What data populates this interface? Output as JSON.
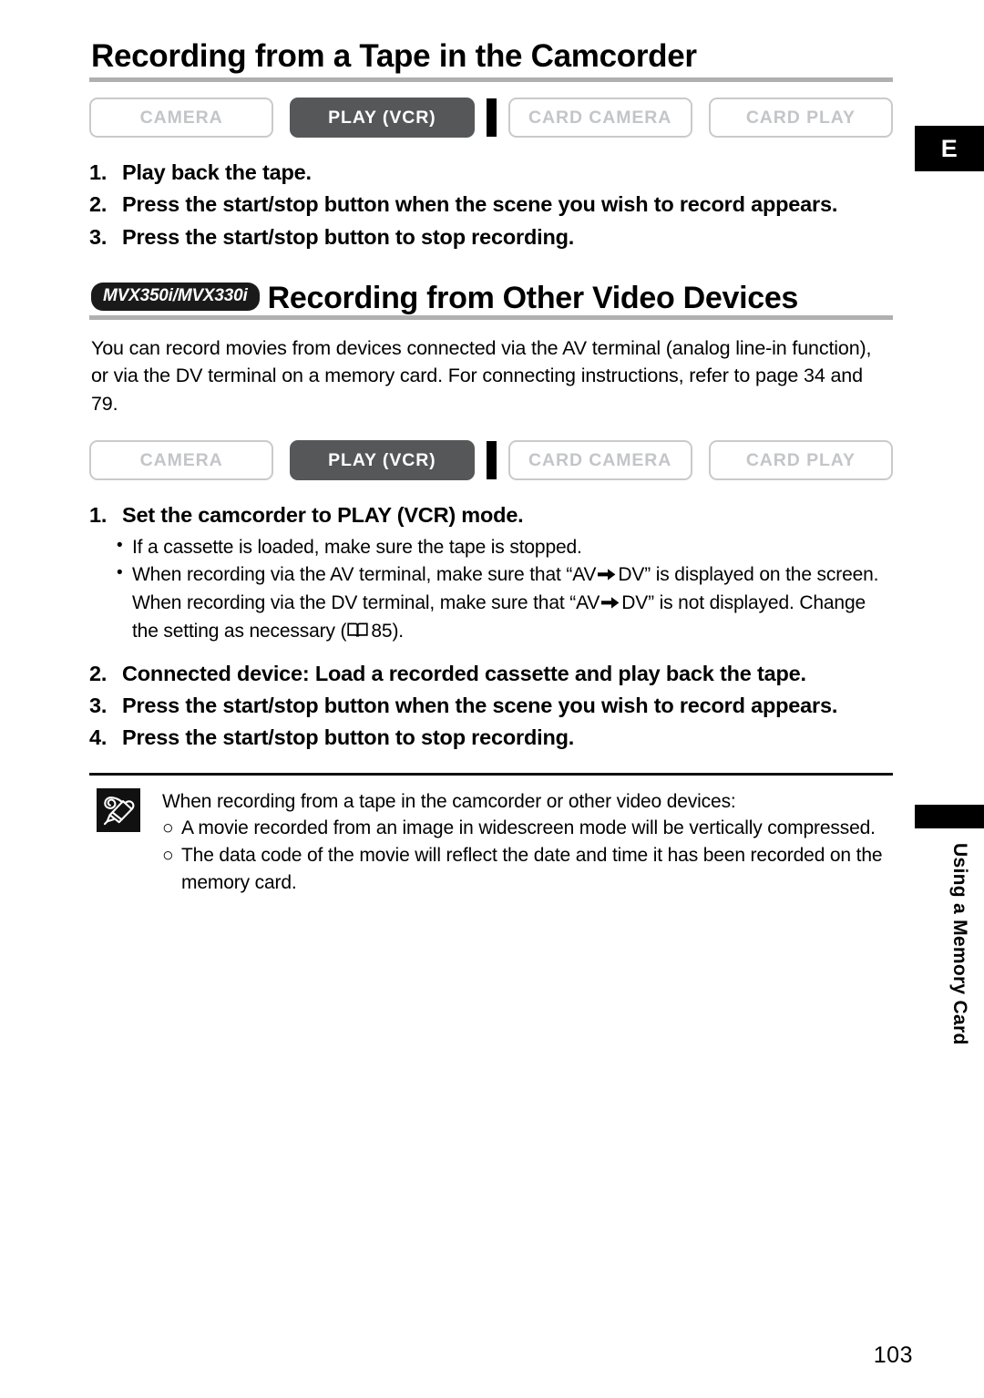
{
  "page": {
    "number": "103",
    "side_label": "Using a Memory Card",
    "edge_tab": "E"
  },
  "section1": {
    "heading": "Recording from a Tape in the Camcorder",
    "mode_bar": {
      "buttons": [
        {
          "label": "CAMERA",
          "state": "inactive"
        },
        {
          "label": "PLAY (VCR)",
          "state": "active"
        },
        {
          "label": "CARD CAMERA",
          "state": "inactive"
        },
        {
          "label": "CARD PLAY",
          "state": "inactive"
        }
      ]
    },
    "steps": [
      {
        "num": "1.",
        "text": "Play back the tape."
      },
      {
        "num": "2.",
        "text": "Press the start/stop button when the scene you wish to record appears."
      },
      {
        "num": "3.",
        "text": "Press the start/stop button to stop recording."
      }
    ]
  },
  "section2": {
    "badge": "MVX350i/MVX330i",
    "heading": "Recording from Other Video Devices",
    "paragraph": "You can record movies from devices connected via the AV terminal (analog line-in function), or via the DV terminal on a memory card. For connecting instructions, refer to page 34 and 79.",
    "mode_bar": {
      "buttons": [
        {
          "label": "CAMERA",
          "state": "inactive"
        },
        {
          "label": "PLAY (VCR)",
          "state": "active"
        },
        {
          "label": "CARD CAMERA",
          "state": "inactive"
        },
        {
          "label": "CARD PLAY",
          "state": "inactive"
        }
      ]
    },
    "step1": {
      "num": "1.",
      "text": "Set the camcorder to PLAY (VCR) mode."
    },
    "step1_bullets": [
      {
        "dot": "•",
        "text": "If a cassette is loaded, make sure the tape is stopped."
      },
      {
        "dot": "•",
        "part1": "When recording via the AV terminal, make sure that “AV",
        "part2": "DV” is displayed on the screen. When recording via the DV terminal, make sure that “AV",
        "part3": "DV” is not displayed. Change the setting as necessary (",
        "page_ref": "85",
        "part4": ")."
      }
    ],
    "steps_rest": [
      {
        "num": "2.",
        "text": "Connected device: Load a recorded cassette and play back the tape."
      },
      {
        "num": "3.",
        "text": "Press the start/stop button when the scene you wish to record appears."
      },
      {
        "num": "4.",
        "text": "Press the start/stop button to stop recording."
      }
    ]
  },
  "notes": {
    "icon": "pencil-note-icon",
    "lead": "When recording from a tape in the camcorder or other video devices:",
    "items": [
      {
        "marker": "○",
        "text": "A movie recorded from an image in widescreen mode will be vertically compressed."
      },
      {
        "marker": "○",
        "text": "The data code of the movie will reflect the date and time it has been recorded on the memory card."
      }
    ]
  },
  "colors": {
    "active_button_bg": "#555759",
    "inactive_button_border": "#c8cacc",
    "inactive_button_text": "#c3c5c8",
    "heading_rule": "#b0b0b0",
    "badge_bg": "#1a1a1a"
  }
}
